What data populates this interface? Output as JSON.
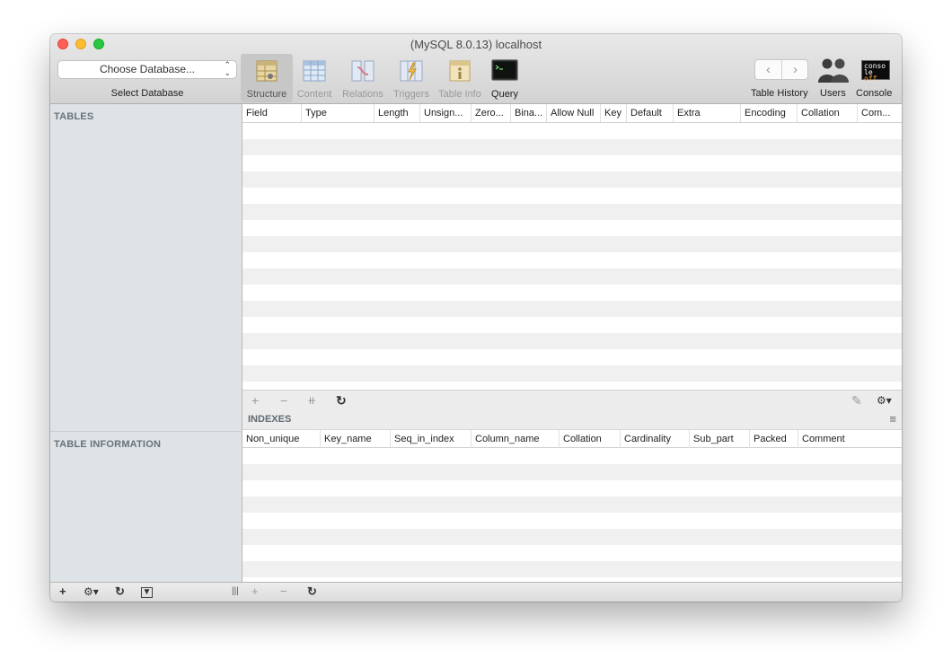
{
  "window": {
    "title": "(MySQL 8.0.13) localhost"
  },
  "database": {
    "select_value": "Choose Database...",
    "select_label": "Select Database"
  },
  "toolbar": {
    "tabs": [
      {
        "label": "Structure",
        "icon": "structure-icon",
        "state": "active"
      },
      {
        "label": "Content",
        "icon": "content-icon",
        "state": "disabled"
      },
      {
        "label": "Relations",
        "icon": "relations-icon",
        "state": "disabled"
      },
      {
        "label": "Triggers",
        "icon": "triggers-icon",
        "state": "disabled"
      },
      {
        "label": "Table Info",
        "icon": "table-info-icon",
        "state": "disabled"
      },
      {
        "label": "Query",
        "icon": "query-icon",
        "state": "enabled"
      }
    ],
    "history_back": "‹",
    "history_forward": "›",
    "table_history_label": "Table History",
    "users_label": "Users",
    "console_label": "Console",
    "console_icon_text_line1": "conso",
    "console_icon_text_line2": "le",
    "console_icon_text_line3": "off"
  },
  "sidebar": {
    "tables_header": "TABLES",
    "table_info_header": "TABLE INFORMATION"
  },
  "structure": {
    "columns": [
      "Field",
      "Type",
      "Length",
      "Unsign...",
      "Zero...",
      "Bina...",
      "Allow Null",
      "Key",
      "Default",
      "Extra",
      "Encoding",
      "Collation",
      "Com..."
    ]
  },
  "indexes": {
    "title": "INDEXES",
    "columns": [
      "Non_unique",
      "Key_name",
      "Seq_in_index",
      "Column_name",
      "Collation",
      "Cardinality",
      "Sub_part",
      "Packed",
      "Comment"
    ]
  },
  "controls": {
    "add": "+",
    "remove": "−",
    "duplicate": "⧺",
    "refresh": "↻",
    "gear": "⚙▾",
    "edit": "✎",
    "filter": "▼",
    "split": "|||",
    "menu": "≡"
  },
  "colors": {
    "sidebar_bg": "#dde3e7",
    "active_tab_bg": "#c7c7c7",
    "close": "#fe5f57",
    "minimize": "#febc2e",
    "maximize": "#28c840"
  }
}
